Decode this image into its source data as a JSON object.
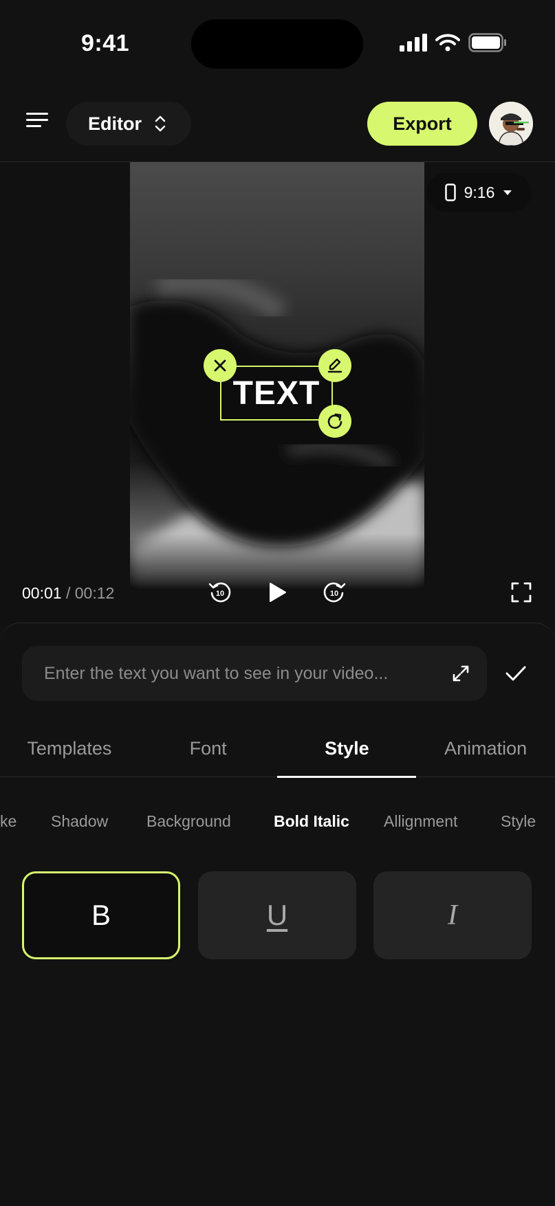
{
  "status_bar": {
    "time": "9:41"
  },
  "header": {
    "mode_label": "Editor",
    "export_label": "Export"
  },
  "preview": {
    "aspect_ratio": "9:16",
    "overlay_text": "TEXT",
    "current_time": "00:01",
    "separator": "/",
    "total_time": "00:12"
  },
  "editor": {
    "text_placeholder": "Enter the text you want to see in your video...",
    "tabs": [
      "Templates",
      "Font",
      "Style",
      "Animation"
    ],
    "active_tab": "Style",
    "subtabs": [
      "ke",
      "Shadow",
      "Background",
      "Bold Italic",
      "Allignment",
      "Style"
    ],
    "active_subtab": "Bold Italic",
    "style_buttons": [
      "B",
      "U",
      "I"
    ]
  },
  "colors": {
    "accent": "#D7F76E",
    "background": "#121212",
    "surface": "#242424"
  },
  "icons": [
    "menu-icon",
    "chevron-updown-icon",
    "phone-icon",
    "caret-down-icon",
    "close-icon",
    "edit-icon",
    "rotate-icon",
    "rewind-10-icon",
    "play-icon",
    "forward-10-icon",
    "fullscreen-icon",
    "expand-icon",
    "check-icon"
  ]
}
